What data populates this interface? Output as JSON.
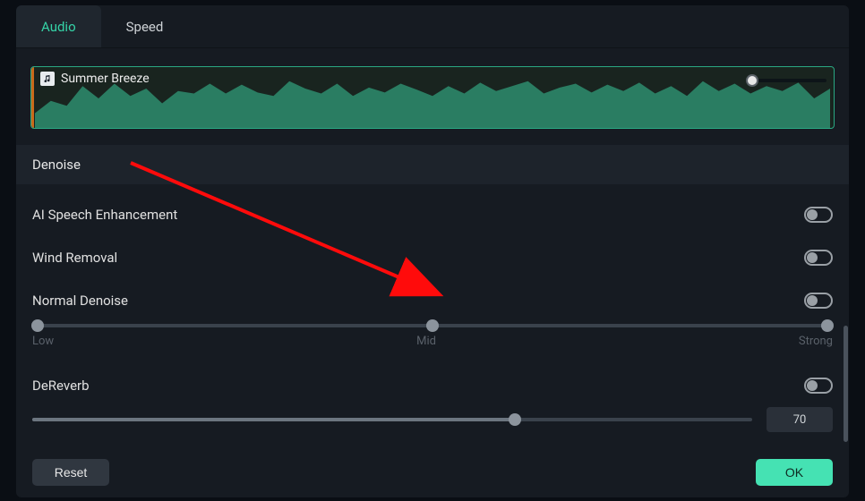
{
  "tabs": {
    "audio": "Audio",
    "speed": "Speed",
    "active": "audio"
  },
  "clip": {
    "title": "Summer Breeze"
  },
  "section": {
    "title": "Denoise"
  },
  "rows": {
    "ai_speech": {
      "label": "AI Speech Enhancement",
      "on": false
    },
    "wind": {
      "label": "Wind Removal",
      "on": false
    },
    "normal": {
      "label": "Normal Denoise",
      "on": false
    },
    "dereverb": {
      "label": "DeReverb",
      "on": false
    }
  },
  "normal_slider": {
    "position_pct": 50,
    "ticks": {
      "low": "Low",
      "mid": "Mid",
      "strong": "Strong"
    }
  },
  "dereverb_slider": {
    "position_pct": 70,
    "value": "70"
  },
  "footer": {
    "reset": "Reset",
    "ok": "OK"
  },
  "colors": {
    "accent": "#45e2b3",
    "arrow": "#ff0b0b"
  }
}
